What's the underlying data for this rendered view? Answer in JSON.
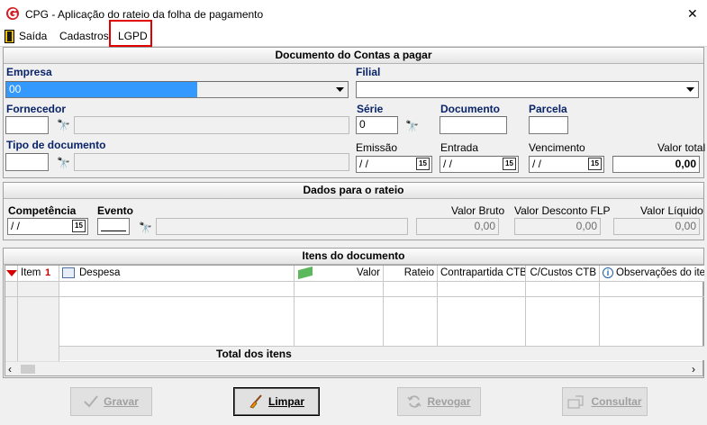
{
  "window": {
    "title": "CPG - Aplicação do rateio da folha de pagamento",
    "close_glyph": "✕"
  },
  "menu": {
    "items": [
      "Saída",
      "Cadastros",
      "LGPD"
    ],
    "highlight_color": "#e00000"
  },
  "documento": {
    "heading": "Documento do Contas a pagar",
    "empresa_label": "Empresa",
    "empresa_value": "00",
    "filial_label": "Filial",
    "filial_value": "",
    "fornecedor_label": "Fornecedor",
    "serie_label": "Série",
    "serie_value": "0",
    "documento_label": "Documento",
    "parcela_label": "Parcela",
    "tipo_label": "Tipo de documento",
    "emissao_label": "Emissão",
    "emissao_value": " / /",
    "entrada_label": "Entrada",
    "entrada_value": " / /",
    "vencimento_label": "Vencimento",
    "vencimento_value": " / /",
    "valor_total_label": "Valor total",
    "valor_total_value": "0,00",
    "calendar_glyph": "15"
  },
  "rateio": {
    "heading": "Dados para o rateio",
    "competencia_label": "Competência",
    "competencia_value": " / /",
    "evento_label": "Evento",
    "valor_bruto_label": "Valor Bruto",
    "valor_bruto_value": "0,00",
    "valor_desconto_label": "Valor Desconto FLP",
    "valor_desconto_value": "0,00",
    "valor_liquido_label": "Valor Líquido",
    "valor_liquido_value": "0,00"
  },
  "itens": {
    "heading": "Itens do documento",
    "columns": [
      "Item",
      "Despesa",
      "Valor",
      "Rateio",
      "Contrapartida CTB",
      "C/Custos CTB",
      "Observações do iter"
    ],
    "total_label": "Total dos itens"
  },
  "buttons": {
    "gravar": "Gravar",
    "limpar": "Limpar",
    "revogar": "Revogar",
    "consultar": "Consultar"
  },
  "icons": {
    "app": "app-logo-icon",
    "binoculars": "binoculars-icon",
    "calendar": "calendar-icon"
  }
}
